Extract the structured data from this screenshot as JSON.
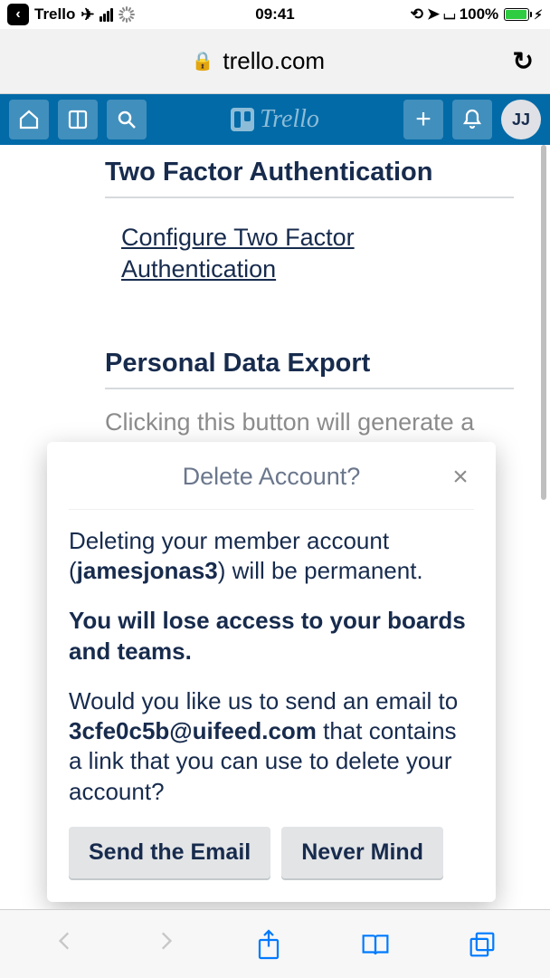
{
  "status_bar": {
    "back_app": "Trello",
    "time": "09:41",
    "battery_pct": "100%"
  },
  "browser": {
    "domain": "trello.com"
  },
  "header": {
    "avatar_initials": "JJ",
    "logo_text": "Trello"
  },
  "sections": {
    "tfa": {
      "title": "Two Factor Authentication",
      "link": "Configure Two Factor Authentication"
    },
    "export": {
      "title": "Personal Data Export",
      "body": "Clicking this button will generate a .json file containing your personal information that's stored in Trello. This includes login credentials and settings, paid account"
    }
  },
  "modal": {
    "title": "Delete Account?",
    "p1_prefix": "Deleting your member account (",
    "p1_user": "jamesjonas3",
    "p1_suffix": ") will be permanent.",
    "p2": "You will lose access to your boards and teams.",
    "p3_prefix": "Would you like us to send an email to ",
    "p3_email": "3cfe0c5b@uifeed.com",
    "p3_suffix": " that contains a link that you can use to delete your account?",
    "btn_send": "Send the Email",
    "btn_cancel": "Never Mind"
  }
}
